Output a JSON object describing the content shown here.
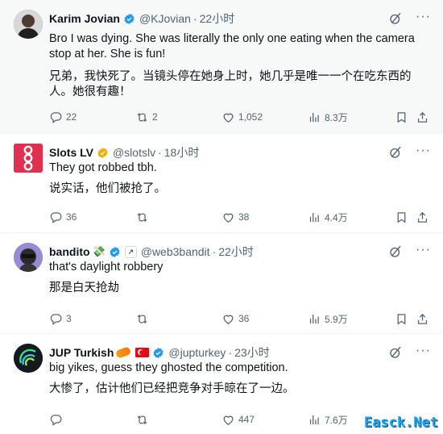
{
  "tweets": [
    {
      "name": "Karim Jovian",
      "handle": "@KJovian",
      "time": "22小时",
      "text": "Bro I was dying. She was literally the only one eating when the camera stop at her. She is fun!",
      "translation": "兄弟，我快死了。当镜头停在她身上时，她几乎是唯一一个在吃东西的人。她很有趣！",
      "replies": "22",
      "reposts": "2",
      "likes": "1,052",
      "views": "8.3万"
    },
    {
      "name": "Slots LV",
      "handle": "@slotslv",
      "time": "18小时",
      "text": "They got robbed tbh.",
      "translation": "说实话，他们被抢了。",
      "replies": "36",
      "reposts": "",
      "likes": "38",
      "views": "4.4万"
    },
    {
      "name": "bandito",
      "handle": "@web3bandit",
      "time": "22小时",
      "text": "that's daylight robbery",
      "translation": "那是白天抢劫",
      "replies": "3",
      "reposts": "",
      "likes": "36",
      "views": "5.9万"
    },
    {
      "name": "JUP Turkish",
      "handle": "@jupturkey",
      "time": "23小时",
      "text": "big yikes, guess they ghosted the competition.",
      "translation": "大惨了，估计他们已经把竞争对手晾在了一边。",
      "replies": "",
      "reposts": "",
      "likes": "447",
      "views": "7.6万"
    }
  ],
  "separator": "·",
  "watermark": "Easck.Net",
  "colors": {
    "verified": "#1d9bf0",
    "gold": "#e8b10b",
    "muted": "#536471"
  }
}
